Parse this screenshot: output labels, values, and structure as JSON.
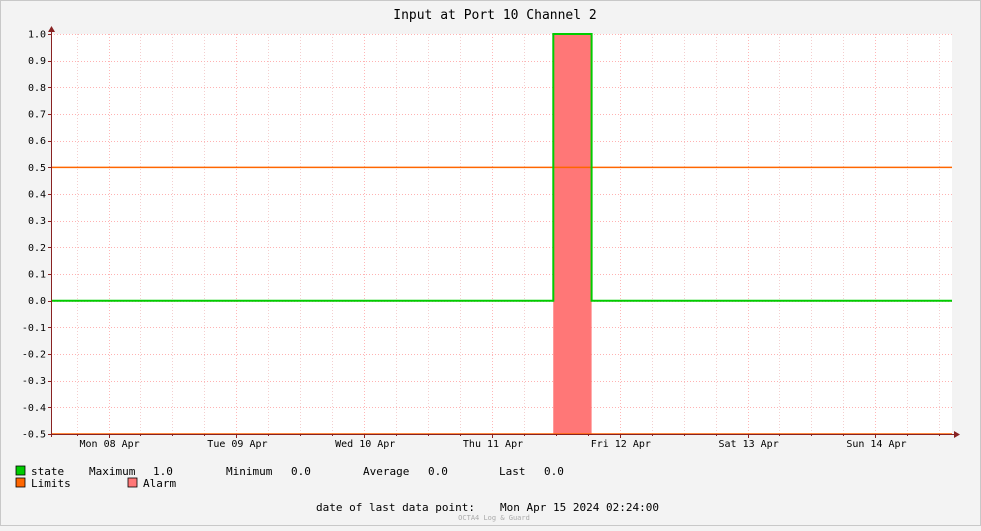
{
  "chart_data": {
    "type": "line",
    "title": "Input at Port 10 Channel 2",
    "xlabel": "",
    "ylabel": "",
    "ylim": [
      -0.5,
      1.0
    ],
    "y_ticks": [
      "1.0",
      "0.9",
      "0.8",
      "0.7",
      "0.6",
      "0.5",
      "0.4",
      "0.3",
      "0.2",
      "0.1",
      "0.0",
      "-0.1",
      "-0.2",
      "-0.3",
      "-0.4",
      "-0.5"
    ],
    "y_tick_values": [
      1.0,
      0.9,
      0.8,
      0.7,
      0.6,
      0.5,
      0.4,
      0.3,
      0.2,
      0.1,
      0.0,
      -0.1,
      -0.2,
      -0.3,
      -0.4,
      -0.5
    ],
    "x_range_days": [
      7.55,
      14.6
    ],
    "x_ticks": [
      {
        "label": "Mon 08 Apr",
        "day": 8.0
      },
      {
        "label": "Tue 09 Apr",
        "day": 9.0
      },
      {
        "label": "Wed 10 Apr",
        "day": 10.0
      },
      {
        "label": "Thu 11 Apr",
        "day": 11.0
      },
      {
        "label": "Fri 12 Apr",
        "day": 12.0
      },
      {
        "label": "Sat 13 Apr",
        "day": 13.0
      },
      {
        "label": "Sun 14 Apr",
        "day": 14.0
      }
    ],
    "grid": true,
    "series": [
      {
        "name": "state",
        "color": "#00cc00",
        "points": [
          [
            7.55,
            0.0
          ],
          [
            11.48,
            0.0
          ],
          [
            11.48,
            1.0
          ],
          [
            11.78,
            1.0
          ],
          [
            11.78,
            0.0
          ],
          [
            14.6,
            0.0
          ]
        ]
      },
      {
        "name": "Limits",
        "color": "#ff6600",
        "values": [
          0.5,
          -0.5
        ]
      },
      {
        "name": "Alarm",
        "color": "#ff7777",
        "regions": [
          [
            11.48,
            11.78
          ]
        ]
      }
    ]
  },
  "legend": {
    "state_label": "state",
    "maximum_label": "Maximum",
    "maximum_value": "1.0",
    "minimum_label": "Minimum",
    "minimum_value": "0.0",
    "average_label": "Average",
    "average_value": "0.0",
    "last_label": "Last",
    "last_value": "0.0",
    "limits_label": "Limits",
    "alarm_label": "Alarm"
  },
  "footer": {
    "date_label": "date of last data point:",
    "date_value": "Mon Apr 15 2024 02:24:00",
    "watermark": "OCTA4 Log & Guard"
  }
}
